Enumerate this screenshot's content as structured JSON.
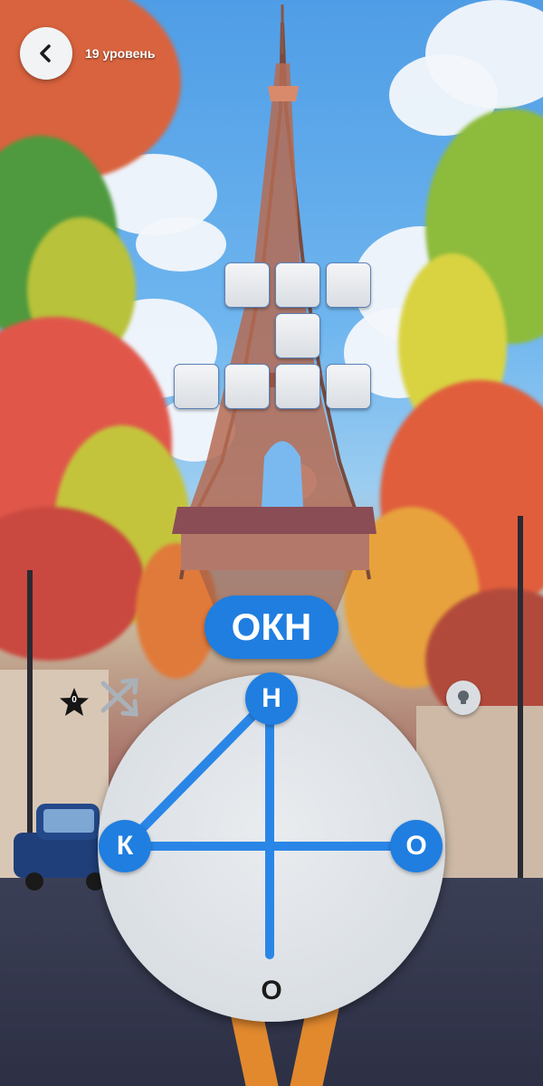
{
  "header": {
    "level_label": "19 уровень",
    "back_icon": "chevron-left-icon"
  },
  "crossword": {
    "cell_color": "#e9ebee",
    "cell_border": "#5b82b8",
    "rows": [
      {
        "cells": 3
      },
      {
        "cells": 1
      },
      {
        "cells": 4
      }
    ]
  },
  "current_word": "ОКН",
  "side_counter": {
    "icon": "star-icon",
    "value": "0"
  },
  "hint": {
    "icon": "lightbulb-icon"
  },
  "wheel": {
    "accent": "#1f7ee0",
    "letters": {
      "top": {
        "char": "Н",
        "selected": true
      },
      "left": {
        "char": "К",
        "selected": true
      },
      "right": {
        "char": "О",
        "selected": true
      },
      "bottom": {
        "char": "О",
        "selected": false
      }
    },
    "shuffle_icon": "shuffle-icon"
  }
}
